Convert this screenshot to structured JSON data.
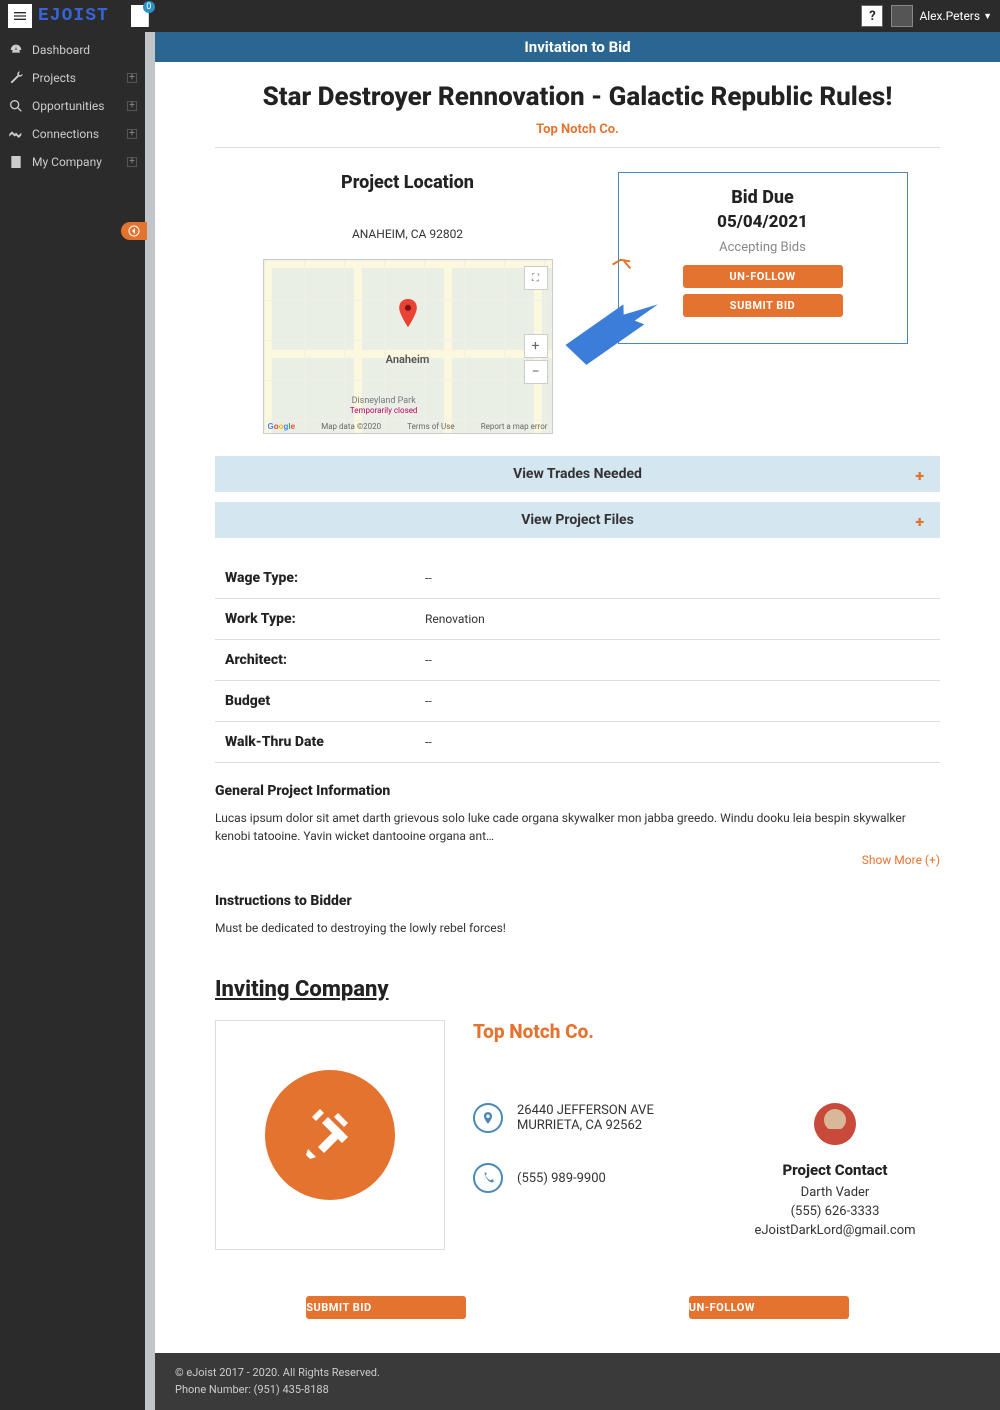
{
  "header": {
    "notif_badge": "0",
    "help": "?",
    "user_name": "Alex.Peters"
  },
  "sidebar": {
    "items": [
      {
        "label": "Dashboard",
        "expandable": false
      },
      {
        "label": "Projects",
        "expandable": true
      },
      {
        "label": "Opportunities",
        "expandable": true
      },
      {
        "label": "Connections",
        "expandable": true
      },
      {
        "label": "My Company",
        "expandable": true
      }
    ]
  },
  "page": {
    "header": "Invitation to Bid",
    "title": "Star Destroyer Rennovation - Galactic Republic Rules!",
    "company": "Top Notch Co.",
    "location_head": "Project Location",
    "location_addr": "ANAHEIM, CA 92802",
    "map": {
      "city": "Anaheim",
      "disney": "Disneyland Park",
      "disney_sub": "Temporarily closed",
      "google": "Google",
      "data": "Map data ©2020",
      "terms": "Terms of Use",
      "report": "Report a map error"
    },
    "bid": {
      "head": "Bid Due",
      "date": "05/04/2021",
      "status": "Accepting Bids",
      "unfollow": "UN-FOLLOW",
      "submit": "SUBMIT BID"
    },
    "accordion": {
      "trades": "View Trades Needed",
      "files": "View Project Files"
    },
    "details": [
      {
        "label": "Wage Type:",
        "value": "--"
      },
      {
        "label": "Work Type:",
        "value": "Renovation"
      },
      {
        "label": "Architect:",
        "value": "--"
      },
      {
        "label": "Budget",
        "value": "--"
      },
      {
        "label": "Walk-Thru Date",
        "value": "--"
      }
    ],
    "general_head": "General Project Information",
    "general_body": "Lucas ipsum dolor sit amet darth grievous solo luke cade organa skywalker mon jabba greedo. Windu dooku leia bespin skywalker kenobi tatooine. Yavin wicket dantooine organa ant…",
    "show_more": "Show More (+)",
    "instructions_head": "Instructions to Bidder",
    "instructions_body": "Must be dedicated to destroying the lowly rebel forces!",
    "inviting_head": "Inviting Company",
    "company_card": {
      "name": "Top Notch Co.",
      "addr1": "26440 JEFFERSON AVE",
      "addr2": "MURRIETA, CA 92562",
      "phone": "(555) 989-9900",
      "contact_head": "Project Contact",
      "contact_name": "Darth Vader",
      "contact_phone": "(555) 626-3333",
      "contact_email": "eJoistDarkLord@gmail.com"
    },
    "bottom": {
      "submit": "SUBMIT BID",
      "unfollow": "UN-FOLLOW"
    }
  },
  "footer": {
    "copy": "© eJoist 2017 - 2020. All Rights Reserved.",
    "phone": "Phone Number: (951) 435-8188"
  }
}
